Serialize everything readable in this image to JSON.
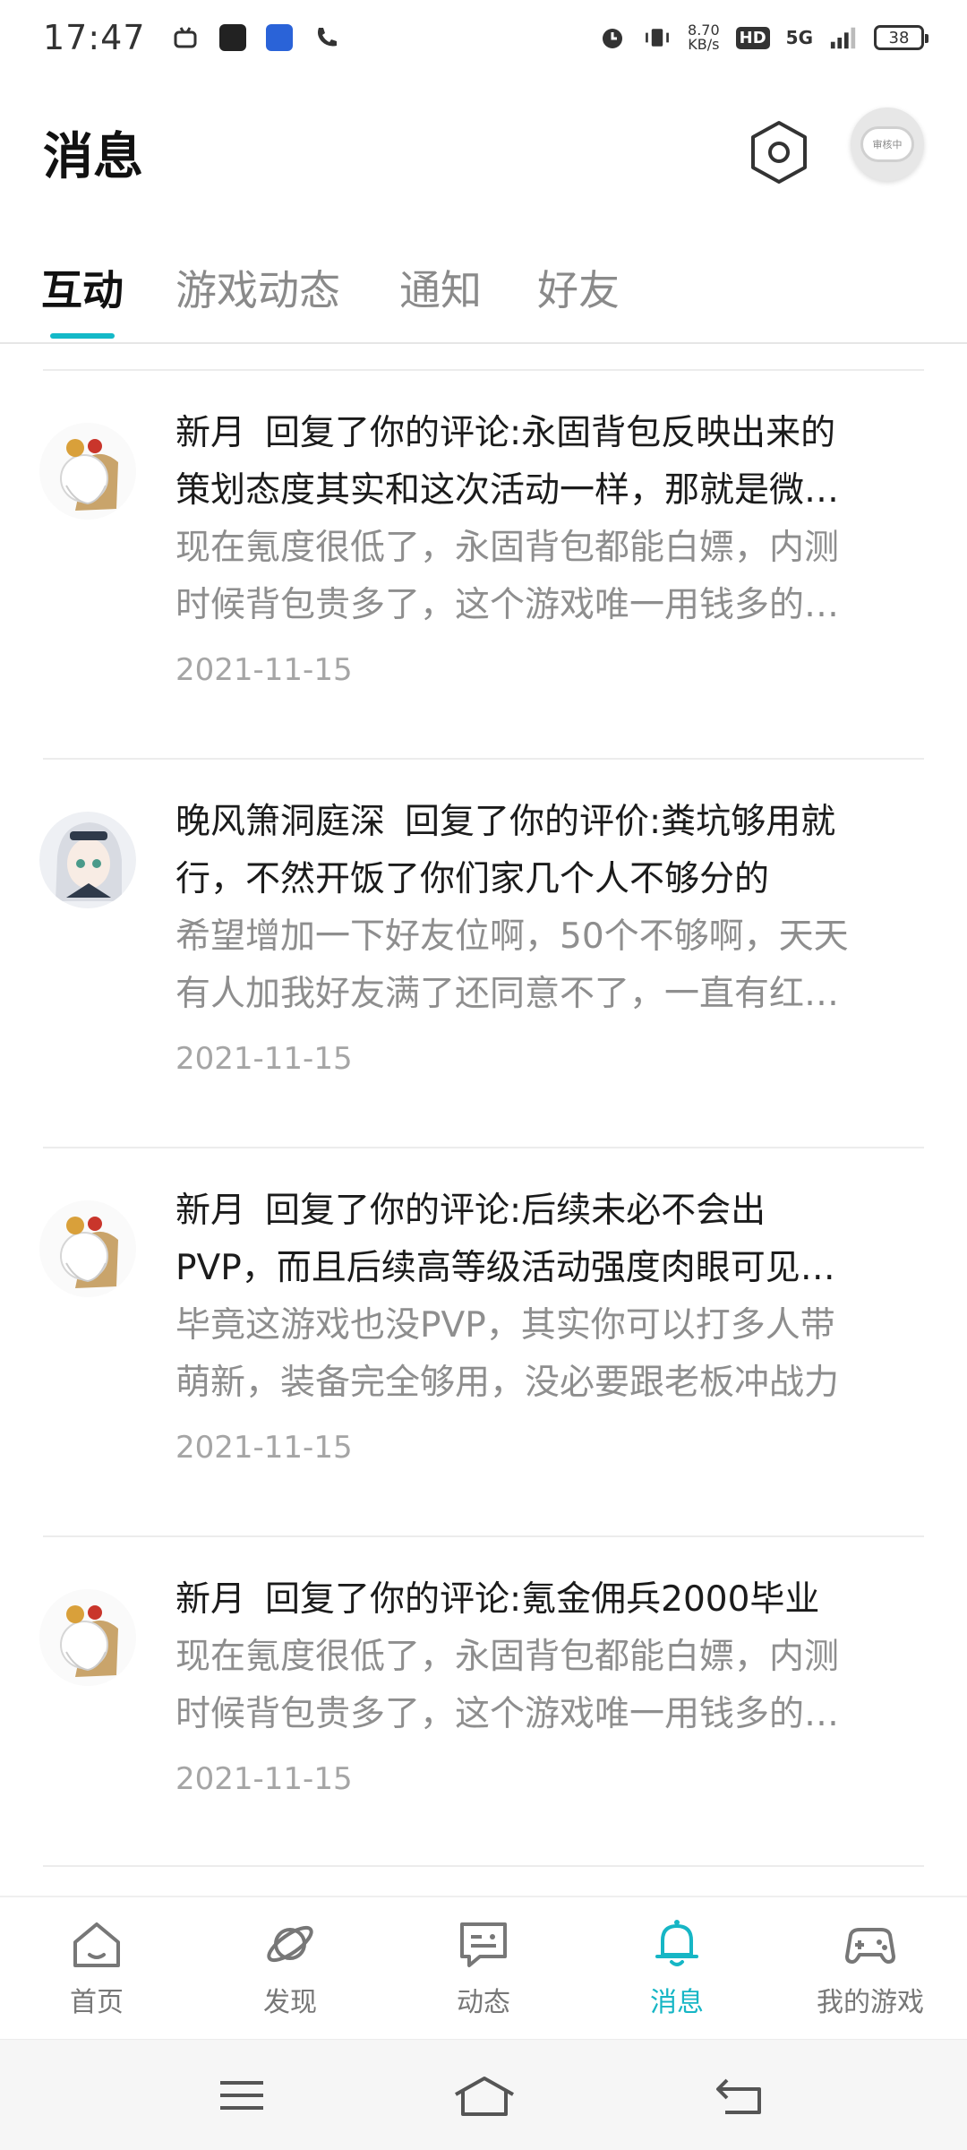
{
  "status_bar": {
    "time": "17:47",
    "net_speed_value": "8.70",
    "net_speed_unit": "KB/s",
    "hd_label": "HD",
    "network_label": "5G",
    "battery": "38"
  },
  "header": {
    "title": "消息",
    "avatar_badge": "审核中"
  },
  "tabs": [
    {
      "label": "互动",
      "active": true
    },
    {
      "label": "游戏动态",
      "active": false
    },
    {
      "label": "通知",
      "active": false
    },
    {
      "label": "好友",
      "active": false
    }
  ],
  "messages": [
    {
      "name": "新月",
      "action": "回复了你的评论:",
      "main_line1": "永固背包反映出来的",
      "main_line2": "策划态度其实和这次活动一样，那就是微…",
      "sub_line1": "现在氪度很低了，永固背包都能白嫖，内测",
      "sub_line2": "时候背包贵多了，这个游戏唯一用钱多的…",
      "date": "2021-11-15"
    },
    {
      "name": "晚风箫洞庭深",
      "action": "回复了你的评价:",
      "main_line1": "粪坑够用就",
      "main_line2": "行，不然开饭了你们家几个人不够分的",
      "sub_line1": "希望增加一下好友位啊，50个不够啊，天天",
      "sub_line2": "有人加我好友满了还同意不了，一直有红…",
      "date": "2021-11-15"
    },
    {
      "name": "新月",
      "action": "回复了你的评论:",
      "main_line1": "后续未必不会出",
      "main_line2": "PVP，而且后续高等级活动强度肉眼可见…",
      "sub_line1": "毕竟这游戏也没PVP，其实你可以打多人带",
      "sub_line2": "萌新，装备完全够用，没必要跟老板冲战力",
      "date": "2021-11-15"
    },
    {
      "name": "新月",
      "action": "回复了你的评论:",
      "main_line1": "氪金佣兵2000毕业",
      "main_line2": "",
      "sub_line1": "现在氪度很低了，永固背包都能白嫖，内测",
      "sub_line2": "时候背包贵多了，这个游戏唯一用钱多的…",
      "date": "2021-11-15"
    }
  ],
  "bottom_nav": [
    {
      "label": "首页",
      "icon": "home-icon"
    },
    {
      "label": "发现",
      "icon": "planet-icon"
    },
    {
      "label": "动态",
      "icon": "chat-icon"
    },
    {
      "label": "消息",
      "icon": "bell-icon",
      "active": true
    },
    {
      "label": "我的游戏",
      "icon": "gamepad-icon"
    }
  ],
  "colors": {
    "accent": "#14b9c8",
    "text_primary": "#1b1b1b",
    "text_secondary": "#8e8e8e"
  }
}
